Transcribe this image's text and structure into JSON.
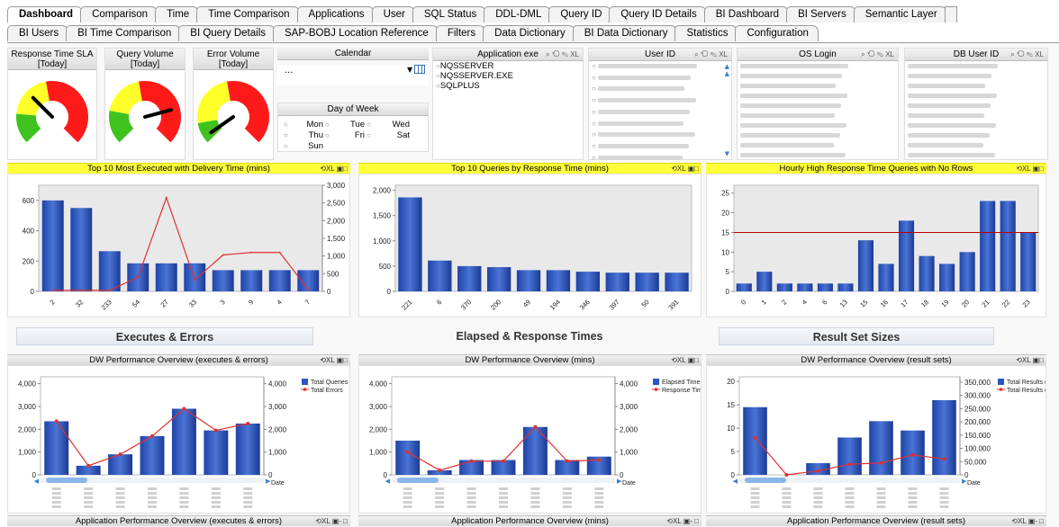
{
  "tabs_row1": [
    "Dashboard",
    "Comparison",
    "Time",
    "Time Comparison",
    "Applications",
    "User",
    "SQL Status",
    "DDL-DML",
    "Query ID",
    "Query ID Details",
    "BI Dashboard",
    "BI Servers",
    "Semantic Layer"
  ],
  "tabs_row2": [
    "BI Users",
    "BI Time Comparison",
    "BI Query Details",
    "SAP-BOBJ Location Reference",
    "Filters",
    "Data Dictionary",
    "BI Data Dictionary",
    "Statistics",
    "Configuration"
  ],
  "active_tab": "Dashboard",
  "gauges": [
    {
      "title": "Response Time SLA\n[Today]",
      "l1": "Response Time SLA",
      "l2": "[Today]"
    },
    {
      "title": "Query Volume [Today]",
      "l1": "Query Volume",
      "l2": "[Today]"
    },
    {
      "title": "Error Volume [Today]",
      "l1": "Error Volume",
      "l2": "[Today]"
    }
  ],
  "calendar": {
    "title": "Calendar",
    "value": "..."
  },
  "day_of_week": {
    "title": "Day of Week",
    "days": [
      "Mon",
      "Tue",
      "Wed",
      "Thu",
      "Fri",
      "Sat",
      "Sun"
    ]
  },
  "application_exe": {
    "title": "Application exe",
    "items": [
      "NQSSERVER",
      "NQSSERVER.EXE",
      "SQLPLUS"
    ]
  },
  "user_id": {
    "title": "User ID"
  },
  "os_login": {
    "title": "OS Login"
  },
  "db_user_id": {
    "title": "DB User ID"
  },
  "charts_top": [
    {
      "title": "Top 10 Most Executed with Delivery Time (mins)"
    },
    {
      "title": "Top 10 Queries by Response Time (mins)"
    },
    {
      "title": "Hourly High Response Time Queries with No Rows"
    }
  ],
  "sections": [
    "Executes & Errors",
    "Elapsed & Response Times",
    "Result Set Sizes"
  ],
  "charts_mid": [
    {
      "title": "DW Performance Overview (executes & errors)",
      "legend": [
        "Total Queries",
        "Total Errors"
      ]
    },
    {
      "title": "DW Performance Overview (mins)",
      "legend": [
        "Elapsed Time",
        "Response Time"
      ]
    },
    {
      "title": "DW Performance Overview (result sets)",
      "legend": [
        "Total Results (GB)",
        "Total Results (K rows)"
      ]
    }
  ],
  "charts_bottom": [
    {
      "title": "Application Performance Overview (executes & errors)"
    },
    {
      "title": "Application Performance Overview (mins)"
    },
    {
      "title": "Application Performance Overview (result sets)"
    }
  ],
  "x_axis_date_label": "Date",
  "chart_data": [
    {
      "type": "bar",
      "title": "Top 10 Most Executed with Delivery Time (mins)",
      "categories": [
        "2",
        "32",
        "233",
        "54",
        "27",
        "33",
        "3",
        "9",
        "4",
        "7"
      ],
      "series": [
        {
          "values": [
            600,
            550,
            265,
            185,
            185,
            185,
            140,
            140,
            140,
            140
          ]
        },
        {
          "values": [
            30,
            30,
            30,
            400,
            2650,
            330,
            1030,
            1100,
            1100,
            50
          ]
        }
      ],
      "ylim": [
        0,
        700
      ],
      "y2lim": [
        0,
        3000
      ],
      "yticks": [
        0,
        200,
        400,
        600
      ],
      "y2ticks": [
        0,
        500,
        1000,
        1500,
        2000,
        2500,
        3000
      ]
    },
    {
      "type": "bar",
      "title": "Top 10 Queries by Response Time (mins)",
      "categories": [
        "221",
        "6",
        "370",
        "200",
        "49",
        "194",
        "346",
        "397",
        "50",
        "391"
      ],
      "values": [
        1860,
        610,
        500,
        480,
        420,
        420,
        390,
        370,
        370,
        370
      ],
      "ylim": [
        0,
        2100
      ],
      "yticks": [
        0,
        500,
        1000,
        1500,
        2000
      ]
    },
    {
      "type": "bar",
      "title": "Hourly High Response Time Queries with No Rows",
      "categories": [
        "0",
        "1",
        "2",
        "4",
        "6",
        "13",
        "15",
        "16",
        "17",
        "18",
        "19",
        "20",
        "21",
        "22",
        "23"
      ],
      "values": [
        2,
        5,
        2,
        2,
        2,
        2,
        13,
        7,
        18,
        9,
        7,
        10,
        23,
        23,
        15
      ],
      "reference_line": 15,
      "ylim": [
        0,
        27
      ],
      "yticks": [
        0,
        5,
        10,
        15,
        20,
        25
      ]
    },
    {
      "type": "bar",
      "title": "DW Performance Overview (executes & errors)",
      "series": [
        {
          "name": "Total Queries",
          "values": [
            2350,
            400,
            900,
            1700,
            2900,
            1950,
            2250
          ]
        },
        {
          "name": "Total Errors",
          "values": [
            2350,
            400,
            900,
            1700,
            2900,
            1950,
            2250
          ]
        }
      ],
      "ylim": [
        0,
        4300
      ],
      "yticks": [
        0,
        1000,
        2000,
        3000,
        4000
      ],
      "y2ticks": [
        0,
        1000,
        2000,
        3000,
        4000
      ]
    },
    {
      "type": "bar",
      "title": "DW Performance Overview (mins)",
      "series": [
        {
          "name": "Elapsed Time",
          "values": [
            1500,
            200,
            650,
            650,
            2100,
            650,
            800
          ]
        },
        {
          "name": "Response Time",
          "values": [
            1000,
            200,
            600,
            600,
            2100,
            600,
            650
          ]
        }
      ],
      "ylim": [
        0,
        4300
      ],
      "yticks": [
        0,
        1000,
        2000,
        3000,
        4000
      ],
      "y2ticks": [
        0,
        1000,
        2000,
        3000,
        4000
      ]
    },
    {
      "type": "bar",
      "title": "DW Performance Overview (result sets)",
      "series": [
        {
          "name": "Total Results (GB)",
          "values": [
            14.5,
            0,
            2.5,
            8,
            11.5,
            9.5,
            16
          ]
        },
        {
          "name": "Total Results (K rows)",
          "values": [
            140000,
            0,
            15000,
            40000,
            45000,
            75000,
            60000
          ]
        }
      ],
      "ylim": [
        0,
        21
      ],
      "yticks": [
        0,
        5,
        10,
        15,
        20
      ],
      "y2ticks": [
        0,
        50000,
        100000,
        150000,
        200000,
        250000,
        300000,
        350000
      ]
    }
  ]
}
